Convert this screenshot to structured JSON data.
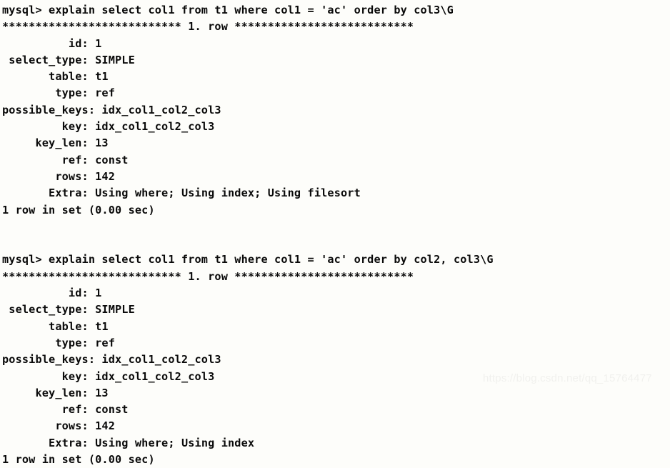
{
  "terminal": {
    "prompt": "mysql> ",
    "separator_prefix": "***************************",
    "separator_label": " 1. row ",
    "separator_suffix": "***************************",
    "blocks": [
      {
        "command": "mysql> explain select col1 from t1 where col1 = 'ac' order by col3\\G",
        "separator": "*************************** 1. row ***************************",
        "fields": [
          {
            "label": "          id: ",
            "value": "1"
          },
          {
            "label": " select_type: ",
            "value": "SIMPLE"
          },
          {
            "label": "       table: ",
            "value": "t1"
          },
          {
            "label": "        type: ",
            "value": "ref"
          },
          {
            "label": "possible_keys: ",
            "value": "idx_col1_col2_col3"
          },
          {
            "label": "         key: ",
            "value": "idx_col1_col2_col3"
          },
          {
            "label": "     key_len: ",
            "value": "13"
          },
          {
            "label": "         ref: ",
            "value": "const"
          },
          {
            "label": "        rows: ",
            "value": "142"
          },
          {
            "label": "       Extra: ",
            "value": "Using where; Using index; Using filesort"
          }
        ],
        "result": "1 row in set (0.00 sec)"
      },
      {
        "command": "mysql> explain select col1 from t1 where col1 = 'ac' order by col2, col3\\G",
        "separator": "*************************** 1. row ***************************",
        "fields": [
          {
            "label": "          id: ",
            "value": "1"
          },
          {
            "label": " select_type: ",
            "value": "SIMPLE"
          },
          {
            "label": "       table: ",
            "value": "t1"
          },
          {
            "label": "        type: ",
            "value": "ref"
          },
          {
            "label": "possible_keys: ",
            "value": "idx_col1_col2_col3"
          },
          {
            "label": "         key: ",
            "value": "idx_col1_col2_col3"
          },
          {
            "label": "     key_len: ",
            "value": "13"
          },
          {
            "label": "         ref: ",
            "value": "const"
          },
          {
            "label": "        rows: ",
            "value": "142"
          },
          {
            "label": "       Extra: ",
            "value": "Using where; Using index"
          }
        ],
        "result": "1 row in set (0.00 sec)"
      }
    ],
    "blank_line": ""
  },
  "watermark": {
    "text": "https://blog.csdn.net/qq_15764477"
  }
}
